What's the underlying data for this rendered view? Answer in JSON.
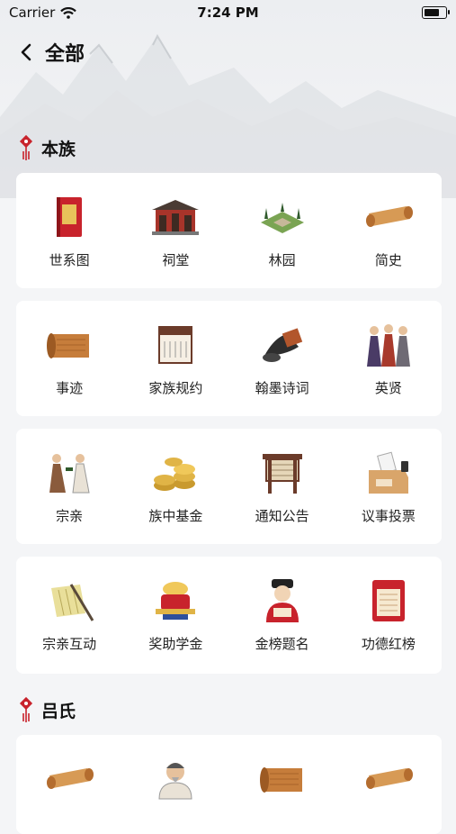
{
  "status_bar": {
    "carrier": "Carrier",
    "time": "7:24 PM"
  },
  "nav": {
    "title": "全部"
  },
  "sections": [
    {
      "title": "本族",
      "rows": [
        [
          {
            "label": "世系图",
            "icon": "family-tree-book-icon"
          },
          {
            "label": "祠堂",
            "icon": "ancestral-hall-icon"
          },
          {
            "label": "林园",
            "icon": "cemetery-garden-icon"
          },
          {
            "label": "简史",
            "icon": "scroll-icon"
          }
        ],
        [
          {
            "label": "事迹",
            "icon": "open-scroll-icon"
          },
          {
            "label": "家族规约",
            "icon": "family-rules-sign-icon"
          },
          {
            "label": "翰墨诗词",
            "icon": "ink-brush-poetry-icon"
          },
          {
            "label": "英贤",
            "icon": "sages-group-icon"
          }
        ],
        [
          {
            "label": "宗亲",
            "icon": "clan-relatives-icon"
          },
          {
            "label": "族中基金",
            "icon": "gold-coins-icon"
          },
          {
            "label": "通知公告",
            "icon": "notice-board-icon"
          },
          {
            "label": "议事投票",
            "icon": "ballot-box-icon"
          }
        ],
        [
          {
            "label": "宗亲互动",
            "icon": "bamboo-letter-brush-icon"
          },
          {
            "label": "奖助学金",
            "icon": "scholar-hat-icon"
          },
          {
            "label": "金榜题名",
            "icon": "top-scholar-icon"
          },
          {
            "label": "功德红榜",
            "icon": "red-honor-board-icon"
          }
        ]
      ]
    },
    {
      "title": "吕氏",
      "rows": [
        [
          {
            "label": "",
            "icon": "scroll-icon"
          },
          {
            "label": "",
            "icon": "ancestor-portrait-icon"
          },
          {
            "label": "",
            "icon": "open-scroll-icon"
          },
          {
            "label": "",
            "icon": "scroll-icon"
          }
        ]
      ]
    }
  ],
  "colors": {
    "accent_red": "#c8232c",
    "card": "#ffffff",
    "background": "#f4f5f7"
  }
}
